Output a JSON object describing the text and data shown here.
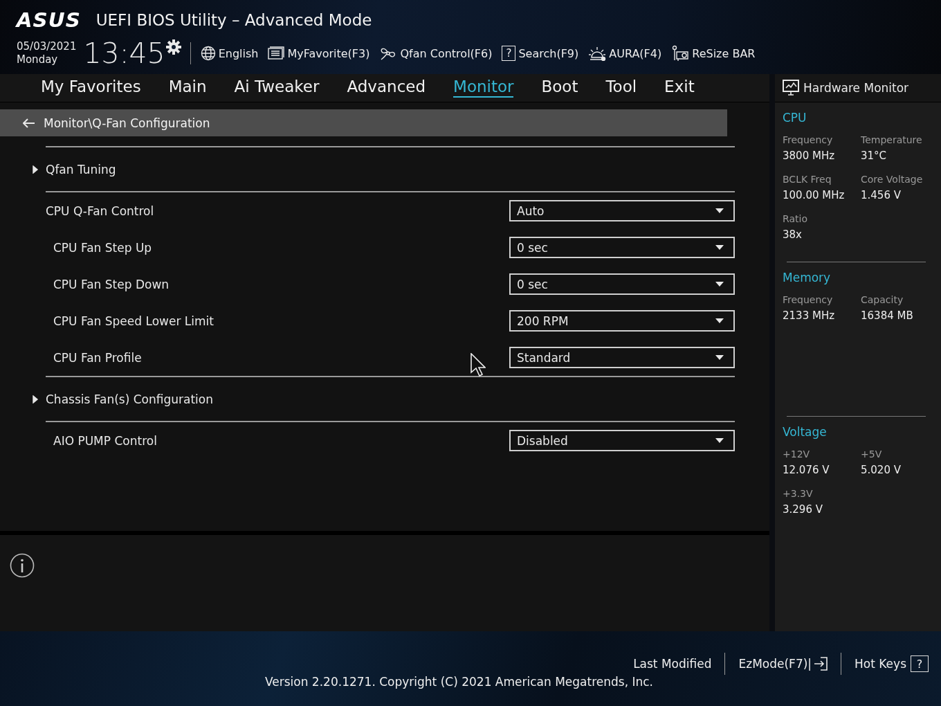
{
  "header": {
    "logo": "ASUS",
    "title": "UEFI BIOS Utility – Advanced Mode",
    "date": "05/03/2021",
    "day": "Monday",
    "time": "13:45",
    "tools": [
      {
        "kind": "globe",
        "label": "English"
      },
      {
        "kind": "list",
        "label": "MyFavorite(F3)"
      },
      {
        "kind": "fan",
        "label": "Qfan Control(F6)"
      },
      {
        "kind": "help",
        "glyph": "?",
        "label": "Search(F9)"
      },
      {
        "kind": "light",
        "label": "AURA(F4)"
      },
      {
        "kind": "card",
        "label": "ReSize BAR"
      }
    ]
  },
  "tabs": [
    {
      "label": "My Favorites",
      "selected": false
    },
    {
      "label": "Main",
      "selected": false
    },
    {
      "label": "Ai Tweaker",
      "selected": false
    },
    {
      "label": "Advanced",
      "selected": false
    },
    {
      "label": "Monitor",
      "selected": true
    },
    {
      "label": "Boot",
      "selected": false
    },
    {
      "label": "Tool",
      "selected": false
    },
    {
      "label": "Exit",
      "selected": false
    }
  ],
  "breadcrumb": "Monitor\\Q-Fan Configuration",
  "items": [
    {
      "kind": "submenu",
      "label": "Qfan Tuning"
    },
    {
      "kind": "setting",
      "label": "CPU Q-Fan Control",
      "value": "Auto"
    },
    {
      "kind": "option",
      "label": "CPU Fan Step Up",
      "value": "0 sec"
    },
    {
      "kind": "option",
      "label": "CPU Fan Step Down",
      "value": "0 sec"
    },
    {
      "kind": "option",
      "label": "CPU Fan Speed Lower Limit",
      "value": "200 RPM"
    },
    {
      "kind": "option",
      "label": "CPU Fan Profile",
      "value": "Standard"
    },
    {
      "kind": "submenu",
      "label": "Chassis Fan(s) Configuration"
    },
    {
      "kind": "option",
      "label": "AIO PUMP Control",
      "value": "Disabled"
    }
  ],
  "hardware_monitor": {
    "title": "Hardware Monitor",
    "sections": [
      {
        "title": "CPU",
        "stats": [
          {
            "label": "Frequency",
            "value": "3800 MHz"
          },
          {
            "label": "Temperature",
            "value": "31°C"
          },
          {
            "label": "BCLK Freq",
            "value": "100.00 MHz"
          },
          {
            "label": "Core Voltage",
            "value": "1.456 V"
          },
          {
            "label": "Ratio",
            "value": "38x"
          }
        ]
      },
      {
        "title": "Memory",
        "stats": [
          {
            "label": "Frequency",
            "value": "2133 MHz"
          },
          {
            "label": "Capacity",
            "value": "16384 MB"
          }
        ]
      },
      {
        "title": "Voltage",
        "stats": [
          {
            "label": "+12V",
            "value": "12.076 V"
          },
          {
            "label": "+5V",
            "value": "5.020 V"
          },
          {
            "label": "+3.3V",
            "value": "3.296 V"
          }
        ]
      }
    ]
  },
  "footer": {
    "last_modified": "Last Modified",
    "ezmode": "EzMode(F7)|",
    "hot_keys": "Hot Keys",
    "hot_keys_glyph": "?",
    "version": "Version 2.20.1271. Copyright (C) 2021 American Megatrends, Inc."
  }
}
